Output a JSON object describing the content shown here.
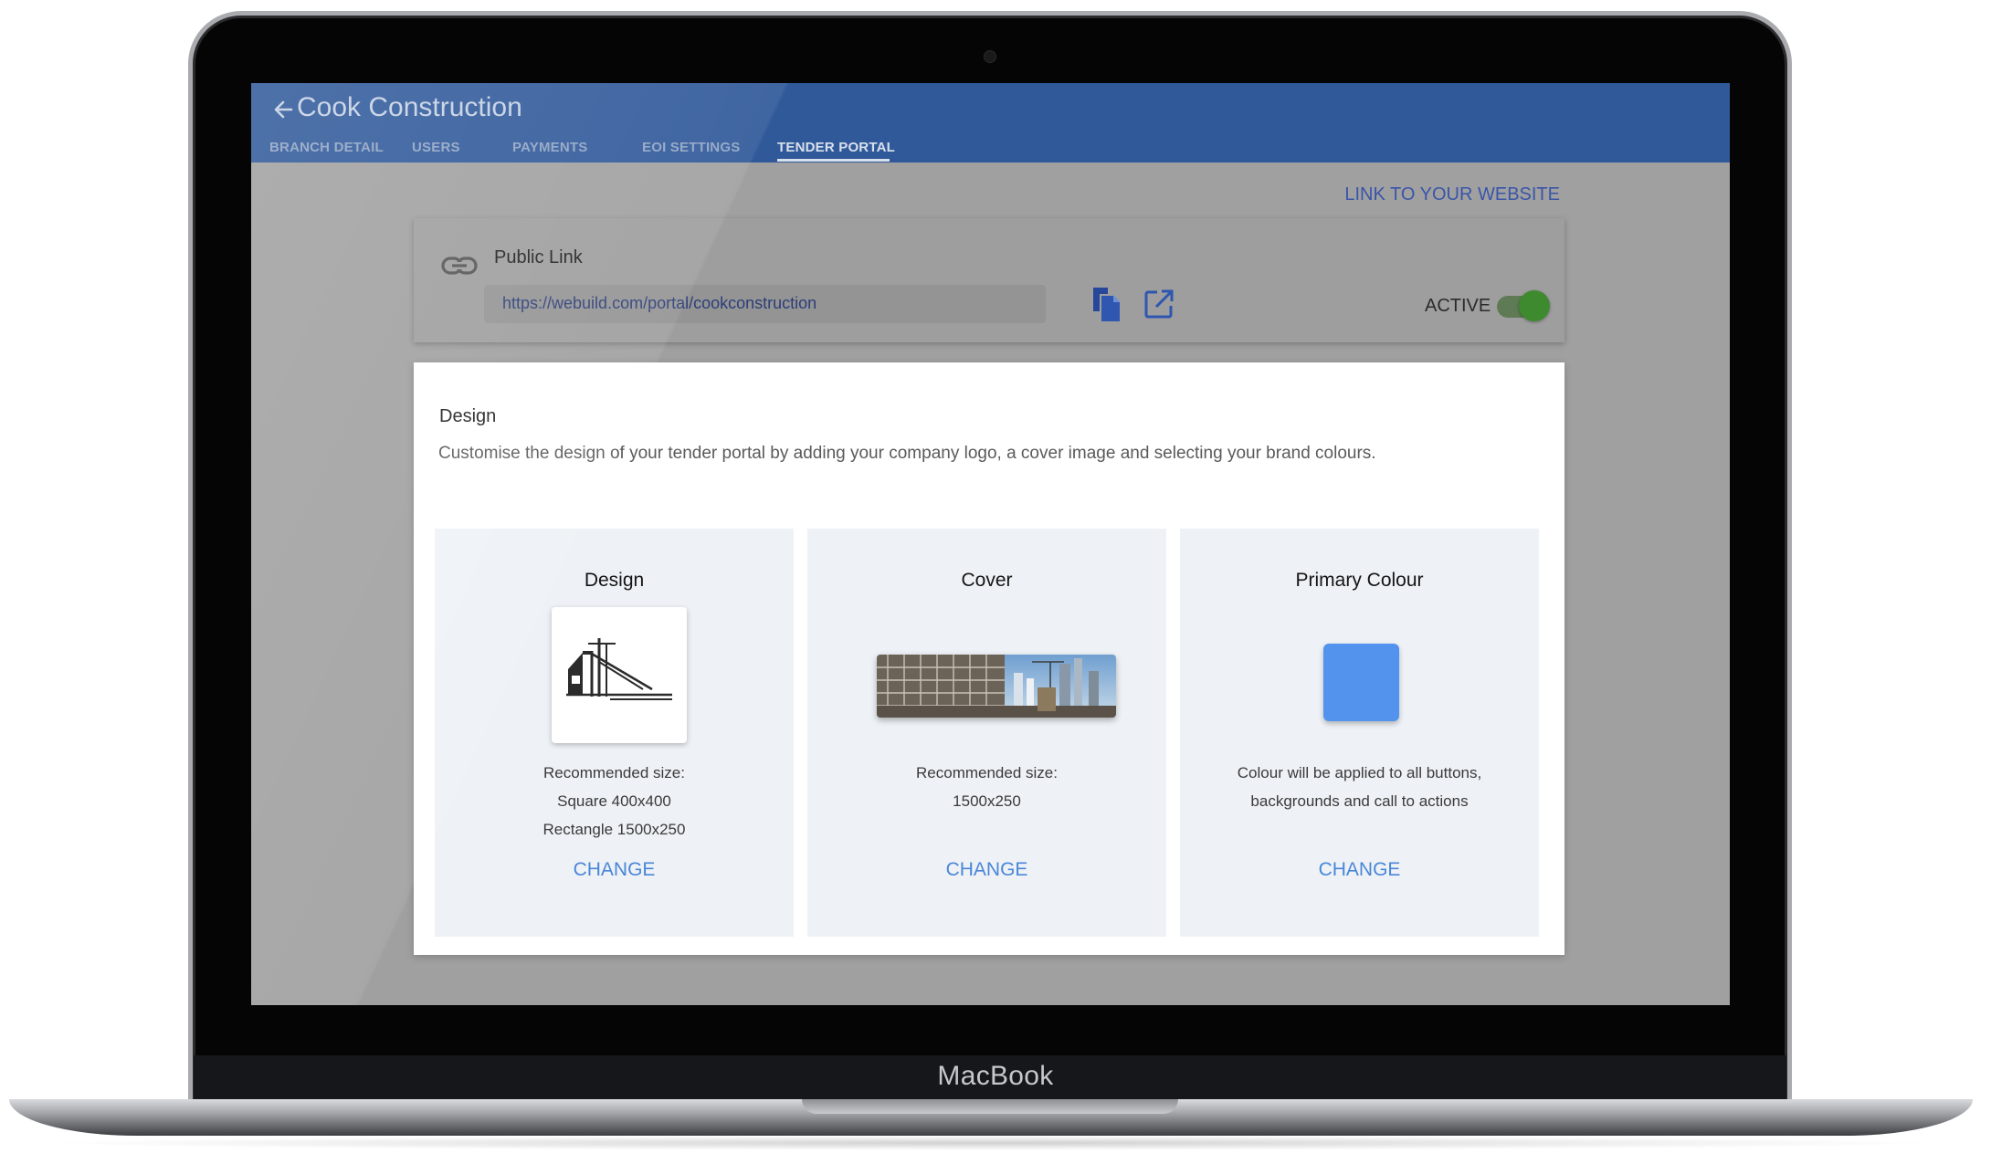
{
  "device": {
    "brand_label": "MacBook"
  },
  "app": {
    "title": "Cook Construction",
    "tabs": [
      {
        "label": "BRANCH DETAIL"
      },
      {
        "label": "USERS"
      },
      {
        "label": "PAYMENTS"
      },
      {
        "label": "EOI SETTINGS"
      },
      {
        "label": "TENDER PORTAL",
        "active": true
      }
    ],
    "link_to_website": "LINK TO YOUR WEBSITE"
  },
  "public_link": {
    "title": "Public Link",
    "url": "https://webuild.com/portal/cookconstruction",
    "status_label": "ACTIVE",
    "active": true
  },
  "design": {
    "title": "Design",
    "description": "Customise the design of your tender portal by adding your company logo, a cover image and selecting your brand colours.",
    "columns": [
      {
        "title": "Design",
        "lines": [
          "Recommended size:",
          "Square 400x400",
          "Rectangle 1500x250"
        ],
        "button": "CHANGE"
      },
      {
        "title": "Cover",
        "lines": [
          "Recommended size:",
          "1500x250"
        ],
        "button": "CHANGE"
      },
      {
        "title": "Primary Colour",
        "lines": [
          "Colour will be applied to all buttons,",
          "backgrounds and call to actions"
        ],
        "button": "CHANGE",
        "swatch_color": "#5393ee"
      }
    ]
  },
  "colors": {
    "app_bar": "#30599a",
    "accent": "#4a86d8",
    "toggle_on": "#3e8a2f"
  }
}
